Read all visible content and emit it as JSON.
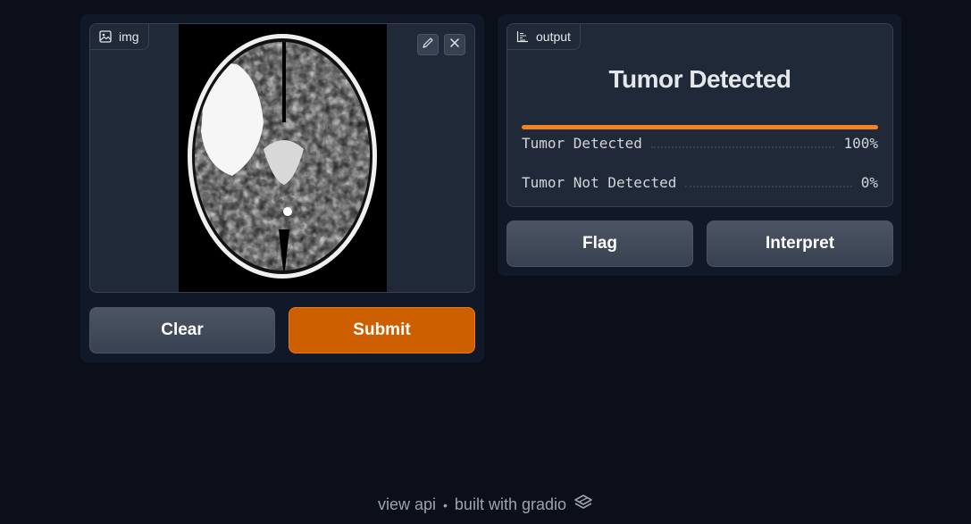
{
  "input": {
    "label": "img",
    "label_icon": "image-icon",
    "edit_icon": "pencil-icon",
    "close_icon": "close-icon"
  },
  "buttons": {
    "clear": "Clear",
    "submit": "Submit",
    "flag": "Flag",
    "interpret": "Interpret"
  },
  "output": {
    "label": "output",
    "label_icon": "bar-chart-icon",
    "title": "Tumor Detected",
    "confidences": [
      {
        "label": "Tumor Detected",
        "value_text": "100%",
        "value": 1.0
      },
      {
        "label": "Tumor Not Detected",
        "value_text": "0%",
        "value": 0.0
      }
    ]
  },
  "footer": {
    "api": "view api",
    "separator": "•",
    "built_with": "built with gradio",
    "logo_icon": "gradio-logo-icon"
  },
  "colors": {
    "background": "#0b0f19",
    "primary": "#cd5f00",
    "bar": "#f58220"
  }
}
